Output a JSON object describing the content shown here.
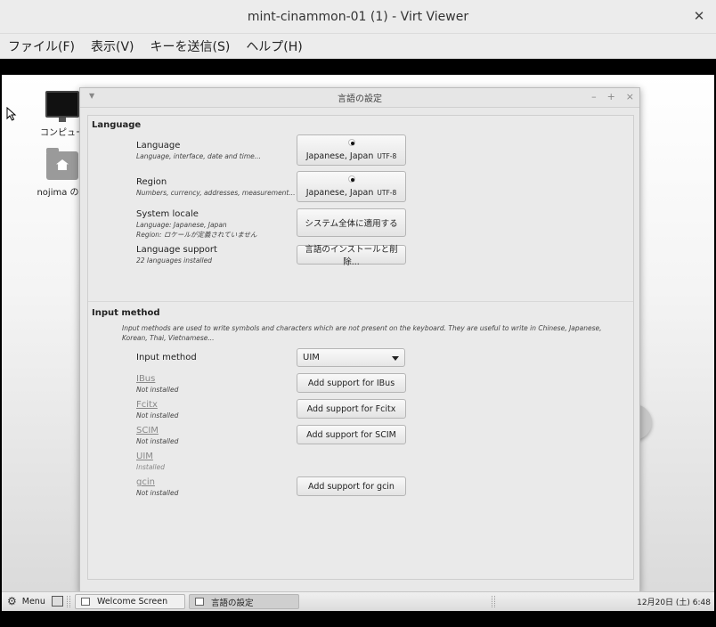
{
  "window": {
    "title": "mint-cinammon-01 (1) - Virt Viewer",
    "close_glyph": "✕"
  },
  "menubar": [
    {
      "label": "ファイル(F)"
    },
    {
      "label": "表示(V)"
    },
    {
      "label": "キーを送信(S)"
    },
    {
      "label": "ヘルプ(H)"
    }
  ],
  "desktop": {
    "icons": [
      {
        "label": "コンピュー",
        "icon": "computer-icon"
      },
      {
        "label": "nojima のホ",
        "icon": "home-folder-icon"
      }
    ]
  },
  "dialog": {
    "title": "言語の設定",
    "controls": {
      "minimize": "–",
      "maximize": "+",
      "close": "×"
    },
    "language_section": {
      "heading": "Language",
      "language": {
        "label": "Language",
        "sub": "Language, interface, date and time...",
        "button_text": "Japanese, Japan",
        "button_enc": "UTF-8"
      },
      "region": {
        "label": "Region",
        "sub": "Numbers, currency, addresses, measurement...",
        "button_text": "Japanese, Japan",
        "button_enc": "UTF-8"
      },
      "system_locale": {
        "label": "System locale",
        "sub1": "Language: Japanese, Japan",
        "sub2": "Region: ロケールが定義されていません",
        "button": "システム全体に適用する"
      },
      "language_support": {
        "label": "Language support",
        "sub": "22 languages installed",
        "button": "言語のインストールと削除..."
      }
    },
    "input_section": {
      "heading": "Input method",
      "description": "Input methods are used to write symbols and characters which are not present on the keyboard. They are useful to write in Chinese, Japanese, Korean, Thai, Vietnamese...",
      "input_method_label": "Input method",
      "input_method_value": "UIM",
      "methods": [
        {
          "name": "IBus",
          "status": "Not installed",
          "button": "Add support for IBus"
        },
        {
          "name": "Fcitx",
          "status": "Not installed",
          "button": "Add support for Fcitx"
        },
        {
          "name": "SCIM",
          "status": "Not installed",
          "button": "Add support for SCIM"
        },
        {
          "name": "UIM",
          "status": "Installed",
          "button": ""
        },
        {
          "name": "gcin",
          "status": "Not installed",
          "button": "Add support for gcin"
        }
      ]
    }
  },
  "taskbar": {
    "menu_label": "Menu",
    "tasks": [
      {
        "label": "Welcome Screen"
      },
      {
        "label": "言語の設定"
      }
    ],
    "clock": "12月20日 (土) 6:48"
  }
}
